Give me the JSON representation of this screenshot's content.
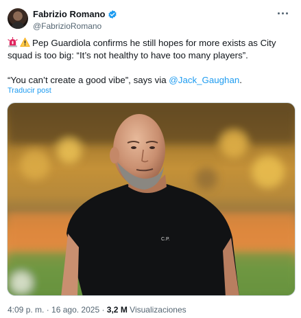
{
  "author": {
    "display_name": "Fabrizio Romano",
    "handle": "@FabrizioRomano",
    "verified": true,
    "avatar_icon": "profile-photo"
  },
  "tweet": {
    "emojis": [
      "rotating-light-icon",
      "warning-icon"
    ],
    "line1": "Pep Guardiola confirms he still hopes for more exists as City squad is too big: “It’s not healthy to have too many players”.",
    "line2_start": "“You can’t create a good vibe”, says via ",
    "mention": "@Jack_Gaughan",
    "line2_end": ".",
    "translate_label": "Traducir post"
  },
  "media": {
    "shirt_logo": "C.P."
  },
  "meta": {
    "time": "4:09 p. m.",
    "separator1": " · ",
    "date": "16 ago. 2025",
    "separator2": " · ",
    "views_count": "3,2 M",
    "views_label": "Visualizaciones"
  },
  "colors": {
    "accent": "#1d9bf0",
    "text": "#0f1419",
    "secondary": "#536471"
  }
}
